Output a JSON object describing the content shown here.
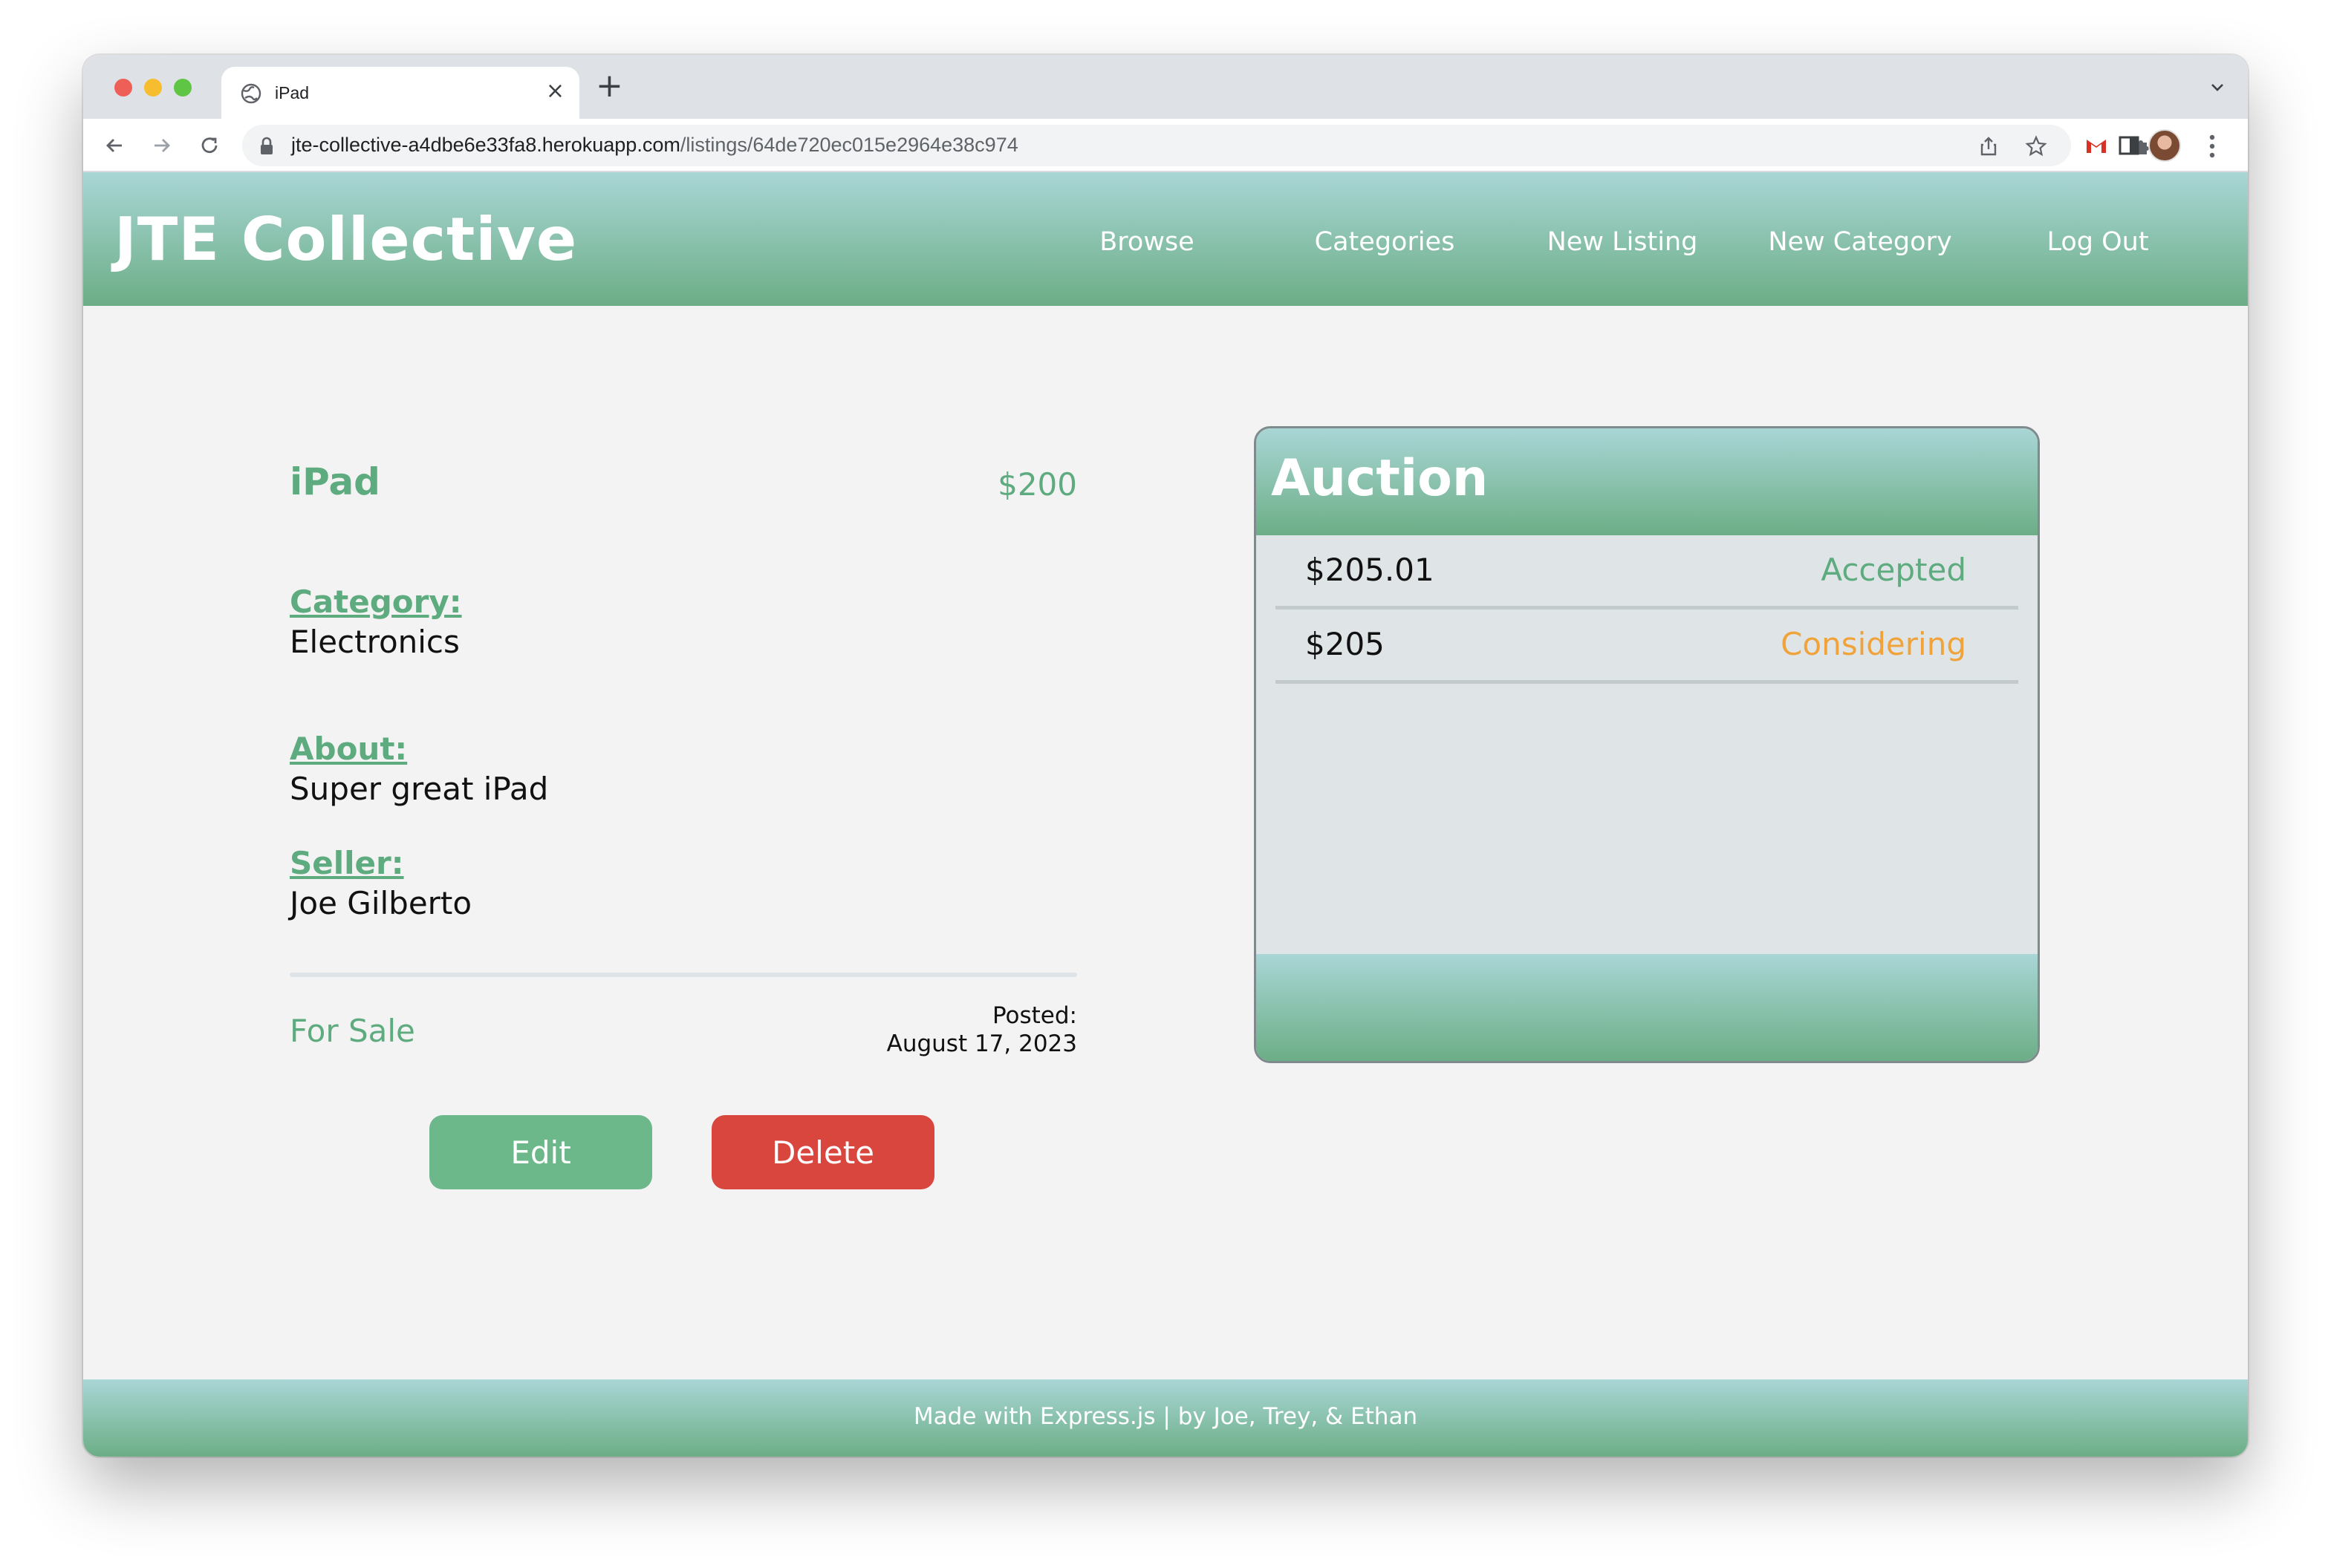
{
  "browser": {
    "tab_title": "iPad",
    "new_tab_symbol": "+",
    "close_symbol": "×",
    "url_host": "jte-collective-a4dbe6e33fa8.herokuapp.com",
    "url_path": "/listings/64de720ec015e2964e38c974"
  },
  "header": {
    "brand": "JTE Collective",
    "nav": [
      "Browse",
      "Categories",
      "New Listing",
      "New Category",
      "Log Out"
    ]
  },
  "listing": {
    "title": "iPad",
    "price": "$200",
    "category_label": "Category:",
    "category": "Electronics",
    "about_label": "About:",
    "about": "Super great iPad",
    "seller_label": "Seller:",
    "seller": "Joe Gilberto",
    "status": "For Sale",
    "posted_label": "Posted:",
    "posted_date": "August 17, 2023",
    "edit_label": "Edit",
    "delete_label": "Delete"
  },
  "auction": {
    "title": "Auction",
    "bids": [
      {
        "amount": "$205.01",
        "status": "Accepted"
      },
      {
        "amount": "$205",
        "status": "Considering"
      }
    ]
  },
  "footer": {
    "text": "Made with Express.js | by Joe, Trey, & Ethan"
  },
  "colors": {
    "accent_green": "#5eab7f",
    "accepted": "#5eab7f",
    "considering": "#f0a33a",
    "delete_red": "#d9463e",
    "edit_green": "#6cb88a"
  },
  "icons": [
    "globe-icon",
    "close-icon",
    "plus-icon",
    "chevron-down-icon",
    "back-arrow-icon",
    "forward-arrow-icon",
    "reload-icon",
    "lock-icon",
    "share-icon",
    "star-icon",
    "gmail-icon",
    "puzzle-icon",
    "sidepanel-icon",
    "avatar",
    "kebab-menu-icon"
  ]
}
